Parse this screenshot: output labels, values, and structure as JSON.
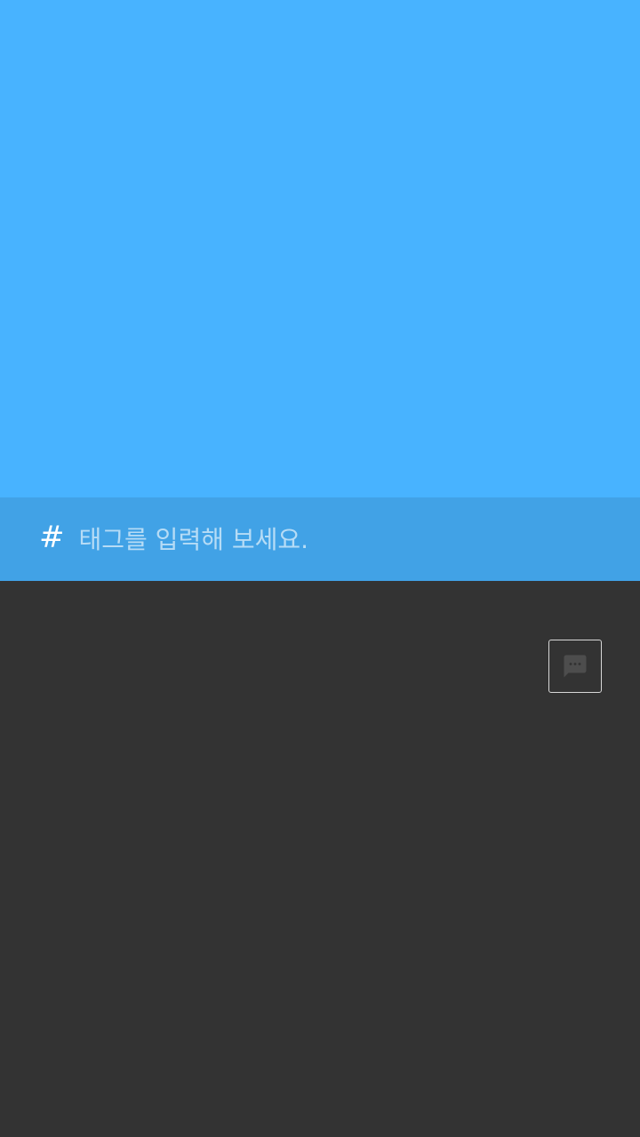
{
  "colors": {
    "canvas_background": "#48b3ff",
    "tag_bar_background": "#41a2e6",
    "bottom_background": "#333333",
    "comment_icon": "#4d4d4d",
    "comment_border": "#d8d8d8"
  },
  "tag_bar": {
    "hash_symbol": "#",
    "placeholder": "태그를 입력해 보세요.",
    "value": ""
  },
  "comment_button": {
    "icon": "comment-bubble-icon"
  }
}
